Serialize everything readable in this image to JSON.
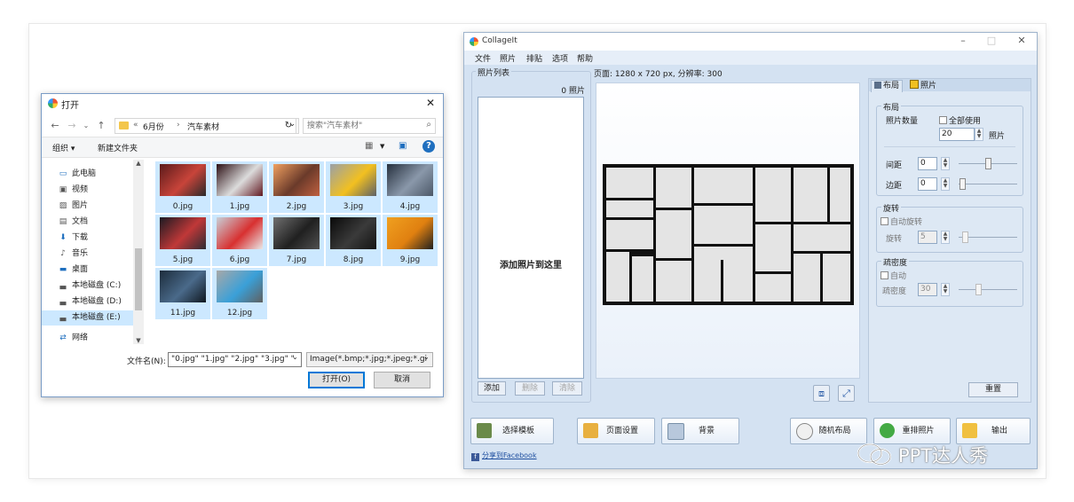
{
  "file_dialog": {
    "title": "打开",
    "address": {
      "breadcrumb": [
        "«",
        "6月份",
        "›",
        "汽车素材"
      ]
    },
    "search_placeholder": "搜索\"汽车素材\"",
    "toolbar": {
      "organize": "组织 ▾",
      "new_folder": "新建文件夹"
    },
    "nav_items": [
      {
        "label": "此电脑",
        "icon": "pc-icon"
      },
      {
        "label": "视频",
        "icon": "video-icon"
      },
      {
        "label": "图片",
        "icon": "picture-icon"
      },
      {
        "label": "文档",
        "icon": "document-icon"
      },
      {
        "label": "下载",
        "icon": "download-icon"
      },
      {
        "label": "音乐",
        "icon": "music-icon"
      },
      {
        "label": "桌面",
        "icon": "desktop-icon"
      },
      {
        "label": "本地磁盘 (C:)",
        "icon": "drive-icon"
      },
      {
        "label": "本地磁盘 (D:)",
        "icon": "drive-icon"
      },
      {
        "label": "本地磁盘 (E:)",
        "icon": "drive-icon",
        "selected": true
      },
      {
        "label": "网络",
        "icon": "network-icon"
      }
    ],
    "files": [
      {
        "name": "0.jpg",
        "colors": [
          "#5a1a1a",
          "#c8443a",
          "#2a2a2a"
        ]
      },
      {
        "name": "1.jpg",
        "colors": [
          "#2c0f14",
          "#dcdcdc",
          "#611820"
        ]
      },
      {
        "name": "2.jpg",
        "colors": [
          "#f0a060",
          "#6a3a2a",
          "#c06040"
        ]
      },
      {
        "name": "3.jpg",
        "colors": [
          "#9aa0a8",
          "#f2c020",
          "#5c6068"
        ]
      },
      {
        "name": "4.jpg",
        "colors": [
          "#26303e",
          "#8a98aa",
          "#4c5868"
        ]
      },
      {
        "name": "5.jpg",
        "colors": [
          "#1a1a22",
          "#c03838",
          "#2c2c34"
        ]
      },
      {
        "name": "6.jpg",
        "colors": [
          "#c8d0d8",
          "#d83030",
          "#e8e8e8"
        ]
      },
      {
        "name": "7.jpg",
        "colors": [
          "#707070",
          "#202020",
          "#505050"
        ]
      },
      {
        "name": "8.jpg",
        "colors": [
          "#0a0a0a",
          "#3a3a3a",
          "#141414"
        ]
      },
      {
        "name": "9.jpg",
        "colors": [
          "#f0a020",
          "#e08010",
          "#202020"
        ]
      },
      {
        "name": "11.jpg",
        "colors": [
          "#1c2c3c",
          "#4a6a8a",
          "#101820"
        ]
      },
      {
        "name": "12.jpg",
        "colors": [
          "#a8a8a8",
          "#3aa0d8",
          "#606060"
        ]
      }
    ],
    "filename_label": "文件名(N):",
    "filename_value": "\"0.jpg\" \"1.jpg\" \"2.jpg\" \"3.jpg\" \"",
    "filter_value": "Image(*.bmp;*.jpg;*.jpeg;*.gi",
    "open_button": "打开(O)",
    "cancel_button": "取消"
  },
  "collageit": {
    "title": "CollageIt",
    "menu": [
      "文件",
      "照片",
      "排贴",
      "选项",
      "帮助"
    ],
    "photo_list": {
      "legend": "照片列表",
      "count": "0 照片",
      "hint": "添加照片到这里",
      "add": "添加",
      "delete": "删除",
      "clear": "清除"
    },
    "page_info": "页面: 1280 x 720 px, 分辨率: 300",
    "tabs": {
      "layout": "布局",
      "photo": "照片"
    },
    "layout_group": {
      "legend": "布局",
      "photo_count_label": "照片数量",
      "use_all": "全部使用",
      "count_value": "20",
      "count_unit": "照片",
      "spacing_label": "间距",
      "spacing_value": "0",
      "margin_label": "边距",
      "margin_value": "0"
    },
    "rotation_group": {
      "legend": "旋转",
      "auto_rotate": "自动旋转",
      "rotation_label": "旋转",
      "rotation_value": "5"
    },
    "density_group": {
      "legend": "疏密度",
      "auto": "自动",
      "density_label": "疏密度",
      "density_value": "30"
    },
    "reset": "重置",
    "bottom_buttons": {
      "choose_template": "选择模板",
      "page_setup": "页面设置",
      "background": "背景",
      "random_layout": "随机布局",
      "rearrange": "重排照片",
      "export": "输出"
    },
    "share": "分享到Facebook"
  },
  "watermark": "PPT达人秀"
}
